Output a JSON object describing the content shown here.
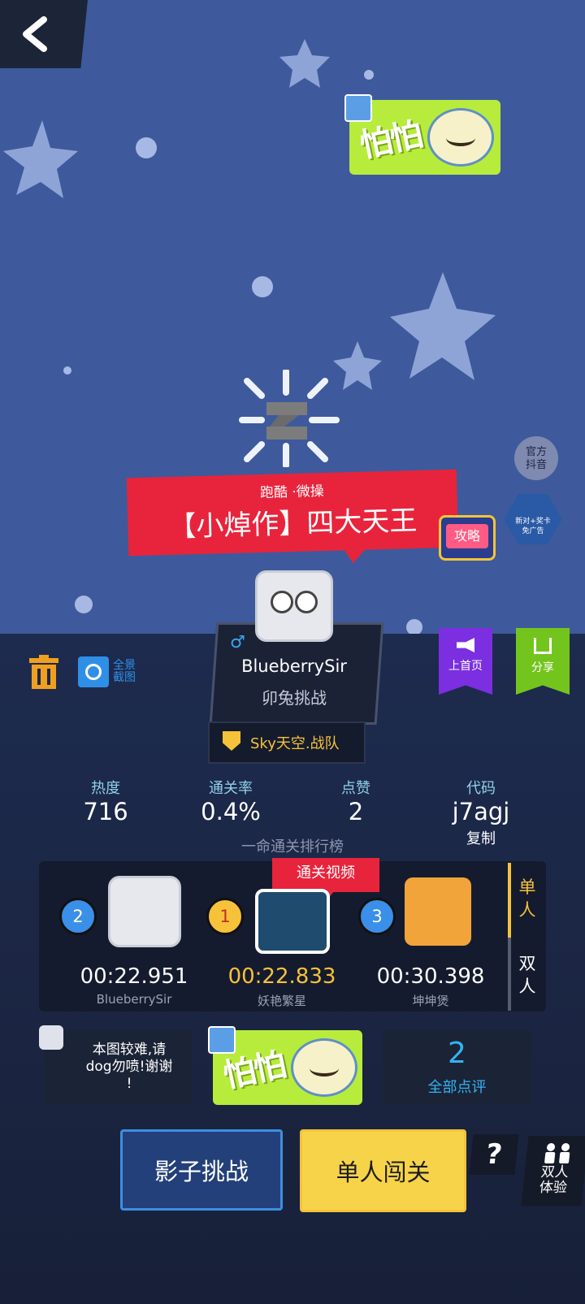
{
  "level": {
    "category": "跑酷 ·微操",
    "title": "【小焯作】四大天王"
  },
  "top_right": {
    "official_label": "官方\n抖音",
    "guide_label": "攻略",
    "ad_badge": "新对+奖卡\n免广告"
  },
  "sticker": {
    "text": "怕怕"
  },
  "author": {
    "gender_symbol": "♂",
    "name": "BlueberrySir",
    "subtitle": "卯兔挑战",
    "team": "Sky天空.战队"
  },
  "toolbar": {
    "screenshot_label": "全景\n截图",
    "promote_label": "上首页",
    "share_label": "分享"
  },
  "stats": {
    "heat_label": "热度",
    "heat_value": "716",
    "pass_label": "通关率",
    "pass_value": "0.4%",
    "like_label": "点赞",
    "like_value": "2",
    "code_label": "代码",
    "code_value": "j7agj",
    "copy_label": "复制"
  },
  "leaderboard": {
    "title": "一命通关排行榜",
    "video_label": "通关视频",
    "tab_single": "单\n人",
    "tab_double": "双\n人",
    "entries": [
      {
        "rank": "2",
        "time": "00:22.951",
        "name": "BlueberrySir"
      },
      {
        "rank": "1",
        "time": "00:22.833",
        "name": "妖艳繁星"
      },
      {
        "rank": "3",
        "time": "00:30.398",
        "name": "坤坤煲"
      }
    ]
  },
  "comments": {
    "preview_text": "本图较难,请\ndog勿喷!谢谢\n!",
    "count": "2",
    "all_label": "全部点评"
  },
  "actions": {
    "shadow_challenge": "影子挑战",
    "single_play": "单人闯关",
    "help": "?",
    "duo_label": "双人\n体验"
  },
  "colors": {
    "sky": "#3e5a9c",
    "banner_red": "#e8243c",
    "accent_yellow": "#f5c23a",
    "sticker_green": "#b7ec3c",
    "promote_purple": "#7b2fe0",
    "share_green": "#74c41e"
  }
}
